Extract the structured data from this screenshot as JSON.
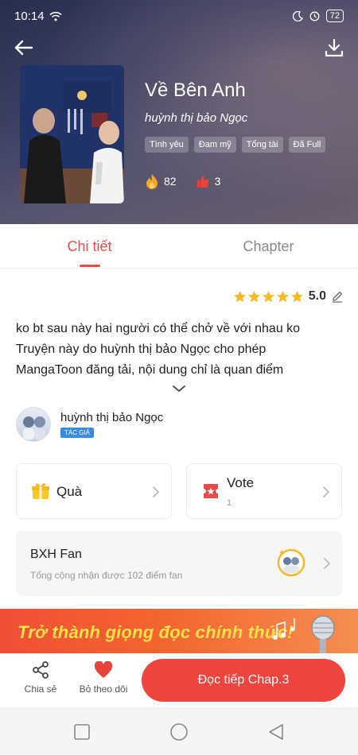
{
  "status_bar": {
    "time": "10:14",
    "battery": "72"
  },
  "book": {
    "title": "Về Bên Anh",
    "author": "huỳnh thị bảo Ngọc",
    "tags": [
      "Tình yêu",
      "Đam mỹ",
      "Tổng tài",
      "Đã Full"
    ],
    "fire_count": "82",
    "like_count": "3"
  },
  "tabs": [
    {
      "label": "Chi tiết",
      "active": true
    },
    {
      "label": "Chapter",
      "active": false
    }
  ],
  "rating": {
    "value": "5.0",
    "stars": 5
  },
  "description": {
    "line1": "ko bt sau này hai người có thể chở về với nhau ko",
    "line2": "Truyện này do huỳnh thị bảo Ngọc cho phép",
    "line3": "MangaToon đăng tải, nội dung chỉ là quan điểm"
  },
  "author_section": {
    "name": "huỳnh thị bảo Ngọc",
    "badge": "TÁC GIẢ"
  },
  "gift_card": {
    "label": "Quà"
  },
  "vote_card": {
    "label": "Vote",
    "count": "1"
  },
  "fan_card": {
    "title": "BXH Fan",
    "subtitle": "Tổng cộng nhận được 102 điểm fan"
  },
  "banner": {
    "text": "Trở thành giọng đọc chính thức!"
  },
  "bottom_bar": {
    "share_label": "Chia sẻ",
    "unfollow_label": "Bỏ theo dõi",
    "read_button": "Đọc tiếp Chap.3"
  },
  "colors": {
    "accent": "#f0453f",
    "tab_active": "#e94a48",
    "star": "#f6b928",
    "badge_blue": "#3b8ae8"
  }
}
